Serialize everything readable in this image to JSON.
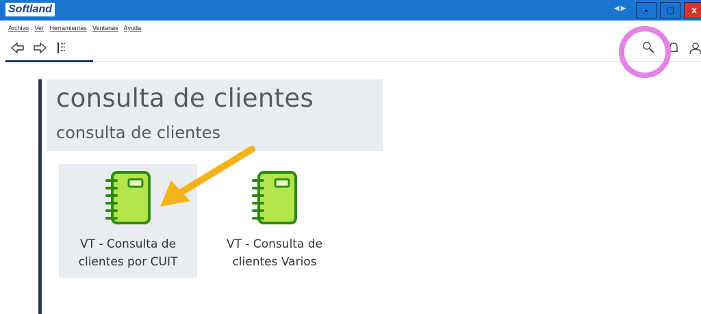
{
  "window": {
    "brand": "Softland",
    "controls": {
      "minimize": "-",
      "maximize": "□",
      "close": "x"
    }
  },
  "menu": [
    "Archivo",
    "Ver",
    "Herramientas",
    "Ventanas",
    "Ayuda"
  ],
  "toolbar": {
    "icons": [
      "arrow-left-icon",
      "arrow-right-icon",
      "tree-list-icon",
      "search-icon",
      "bell-icon",
      "user-icon"
    ]
  },
  "page": {
    "title": "consulta de clientes",
    "subtitle": "consulta de clientes"
  },
  "items": [
    {
      "line1": "VT - Consulta de",
      "line2": "clientes por CUIT",
      "icon": "notebook-icon",
      "selected": true
    },
    {
      "line1": "VT - Consulta de",
      "line2": "clientes Varios",
      "icon": "notebook-icon",
      "selected": false
    }
  ],
  "colors": {
    "titlebar": "#1a75d2",
    "notebook_fill": "#b4e64b",
    "notebook_stroke": "#2e8b10",
    "highlight": "#e384e5",
    "arrow": "#f6b21b"
  }
}
